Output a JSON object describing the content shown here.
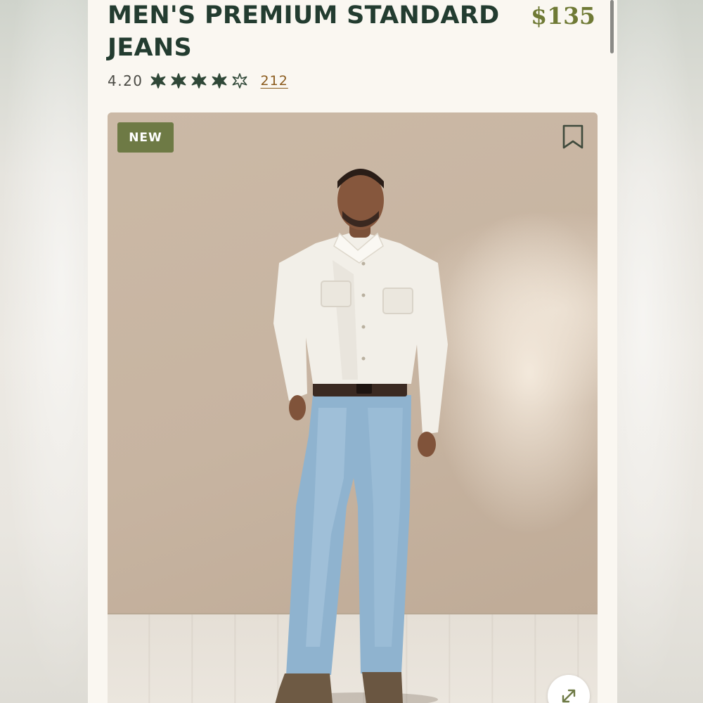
{
  "product": {
    "title": "MEN'S PREMIUM STANDARD JEANS",
    "price": "$135",
    "rating_value": "4.20",
    "rating": 4.2,
    "rating_max": 5,
    "review_count": "212"
  },
  "image": {
    "badge_label": "NEW",
    "bookmark_icon": "bookmark-icon",
    "expand_icon": "expand-icon"
  },
  "colors": {
    "title": "#233c30",
    "price": "#6f7a35",
    "star": "#2f4737",
    "badge": "#6e7a45",
    "review_link": "#8a5a1c"
  }
}
